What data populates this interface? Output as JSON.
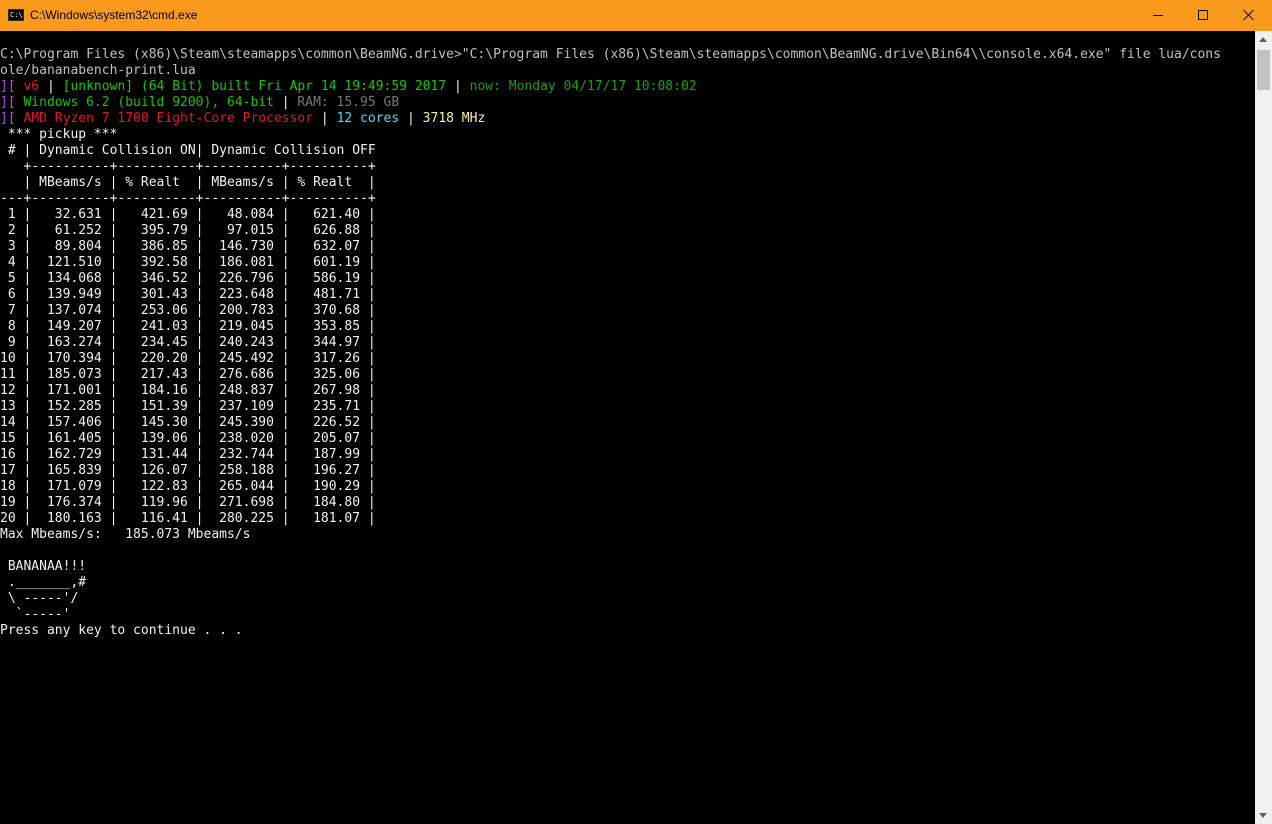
{
  "window": {
    "title": "C:\\Windows\\system32\\cmd.exe",
    "icon": "cmd-icon",
    "icon_text": "C:\\",
    "titlebar_color": "#fa9a1c"
  },
  "controls": {
    "minimize_icon": "minimize-icon",
    "maximize_icon": "maximize-icon",
    "close_icon": "close-icon"
  },
  "colors": {
    "default": "#c0c0c0",
    "white": "#f2f2f2",
    "magenta": "#b24fd6",
    "red": "#e0162b",
    "yellow": "#f9f1a5",
    "green_bright": "#16c60c",
    "green_dim": "#13a10e",
    "gray": "#767676",
    "cyan": "#3de1ff",
    "yellow_dark": "#c19c00"
  },
  "console": {
    "lines": [
      {
        "segs": [
          {
            "t": "C:\\Program Files (x86)\\Steam\\steamapps\\common\\BeamNG.drive>\"C:\\Program Files (x86)\\Steam\\steamapps\\common\\BeamNG.drive\\Bin64\\\\console.x64.exe\" file lua/cons",
            "c": "default"
          }
        ]
      },
      {
        "segs": [
          {
            "t": "ole/bananabench-print.lua",
            "c": "default"
          }
        ]
      },
      {
        "segs": [
          {
            "t": "][ ",
            "c": "magenta"
          },
          {
            "t": "v6",
            "c": "red"
          },
          {
            "t": " | ",
            "c": "white"
          },
          {
            "t": "[unknown] (64 Bit) built Fri Apr 14 19:49:59 2017",
            "c": "green_bright"
          },
          {
            "t": " | ",
            "c": "white"
          },
          {
            "t": "now: Monday 04/17/17 10:08:02",
            "c": "green_dim"
          }
        ]
      },
      {
        "segs": [
          {
            "t": "][ ",
            "c": "magenta"
          },
          {
            "t": "Windows 6.2 (build 9200), 64-bit",
            "c": "green_bright"
          },
          {
            "t": " | ",
            "c": "white"
          },
          {
            "t": "RAM: 15.95 GB",
            "c": "gray"
          }
        ]
      },
      {
        "segs": [
          {
            "t": "][ ",
            "c": "magenta"
          },
          {
            "t": "AMD Ryzen 7 1700 Eight-Core Processor",
            "c": "red"
          },
          {
            "t": " | ",
            "c": "white"
          },
          {
            "t": "12 cores",
            "c": "cyan"
          },
          {
            "t": " | ",
            "c": "white"
          },
          {
            "t": "3718 MHz",
            "c": "yellow"
          }
        ]
      },
      {
        "segs": [
          {
            "t": " *** pickup ***",
            "c": "white"
          }
        ]
      },
      {
        "segs": [
          {
            "t": " # | Dynamic Collision ON| Dynamic Collision OFF",
            "c": "white"
          }
        ]
      },
      {
        "segs": [
          {
            "t": "   +----------+----------+----------+----------+",
            "c": "white"
          }
        ]
      },
      {
        "segs": [
          {
            "t": "   | MBeams/s | % Realt  | MBeams/s | % Realt  |",
            "c": "white"
          }
        ]
      },
      {
        "segs": [
          {
            "t": "---+----------+----------+----------+----------+",
            "c": "white"
          }
        ]
      },
      {
        "segs": [
          {
            "t": " 1 |   32.631 |   421.69 |   48.084 |   621.40 |",
            "c": "white"
          }
        ]
      },
      {
        "segs": [
          {
            "t": " 2 |   61.252 |   395.79 |   97.015 |   626.88 |",
            "c": "white"
          }
        ]
      },
      {
        "segs": [
          {
            "t": " 3 |   89.804 |   386.85 |  146.730 |   632.07 |",
            "c": "white"
          }
        ]
      },
      {
        "segs": [
          {
            "t": " 4 |  121.510 |   392.58 |  186.081 |   601.19 |",
            "c": "white"
          }
        ]
      },
      {
        "segs": [
          {
            "t": " 5 |  134.068 |   346.52 |  226.796 |   586.19 |",
            "c": "white"
          }
        ]
      },
      {
        "segs": [
          {
            "t": " 6 |  139.949 |   301.43 |  223.648 |   481.71 |",
            "c": "white"
          }
        ]
      },
      {
        "segs": [
          {
            "t": " 7 |  137.074 |   253.06 |  200.783 |   370.68 |",
            "c": "white"
          }
        ]
      },
      {
        "segs": [
          {
            "t": " 8 |  149.207 |   241.03 |  219.045 |   353.85 |",
            "c": "white"
          }
        ]
      },
      {
        "segs": [
          {
            "t": " 9 |  163.274 |   234.45 |  240.243 |   344.97 |",
            "c": "white"
          }
        ]
      },
      {
        "segs": [
          {
            "t": "10 |  170.394 |   220.20 |  245.492 |   317.26 |",
            "c": "white"
          }
        ]
      },
      {
        "segs": [
          {
            "t": "11 |  185.073 |   217.43 |  276.686 |   325.06 |",
            "c": "white"
          }
        ]
      },
      {
        "segs": [
          {
            "t": "12 |  171.001 |   184.16 |  248.837 |   267.98 |",
            "c": "white"
          }
        ]
      },
      {
        "segs": [
          {
            "t": "13 |  152.285 |   151.39 |  237.109 |   235.71 |",
            "c": "white"
          }
        ]
      },
      {
        "segs": [
          {
            "t": "14 |  157.406 |   145.30 |  245.390 |   226.52 |",
            "c": "white"
          }
        ]
      },
      {
        "segs": [
          {
            "t": "15 |  161.405 |   139.06 |  238.020 |   205.07 |",
            "c": "white"
          }
        ]
      },
      {
        "segs": [
          {
            "t": "16 |  162.729 |   131.44 |  232.744 |   187.99 |",
            "c": "white"
          }
        ]
      },
      {
        "segs": [
          {
            "t": "17 |  165.839 |   126.07 |  258.188 |   196.27 |",
            "c": "white"
          }
        ]
      },
      {
        "segs": [
          {
            "t": "18 |  171.079 |   122.83 |  265.044 |   190.29 |",
            "c": "white"
          }
        ]
      },
      {
        "segs": [
          {
            "t": "19 |  176.374 |   119.96 |  271.698 |   184.80 |",
            "c": "white"
          }
        ]
      },
      {
        "segs": [
          {
            "t": "20 |  180.163 |   116.41 |  280.225 |   181.07 |",
            "c": "white"
          }
        ]
      },
      {
        "segs": [
          {
            "t": "Max Mbeams/s:   185.073 Mbeams/s",
            "c": "white"
          }
        ]
      },
      {
        "segs": [
          {
            "t": "",
            "c": "white"
          }
        ]
      },
      {
        "segs": [
          {
            "t": " BANANAA!!!",
            "c": "white"
          }
        ]
      },
      {
        "segs": [
          {
            "t": " ._______,#",
            "c": "white"
          }
        ]
      },
      {
        "segs": [
          {
            "t": " \\ -----'/",
            "c": "white"
          }
        ]
      },
      {
        "segs": [
          {
            "t": "  `-----'",
            "c": "white"
          }
        ]
      },
      {
        "segs": [
          {
            "t": "Press any key to continue . . .",
            "c": "white"
          }
        ]
      }
    ]
  },
  "scrollbar": {
    "up_icon": "scroll-up-arrow-icon",
    "down_icon": "scroll-down-arrow-icon",
    "position": 0
  }
}
